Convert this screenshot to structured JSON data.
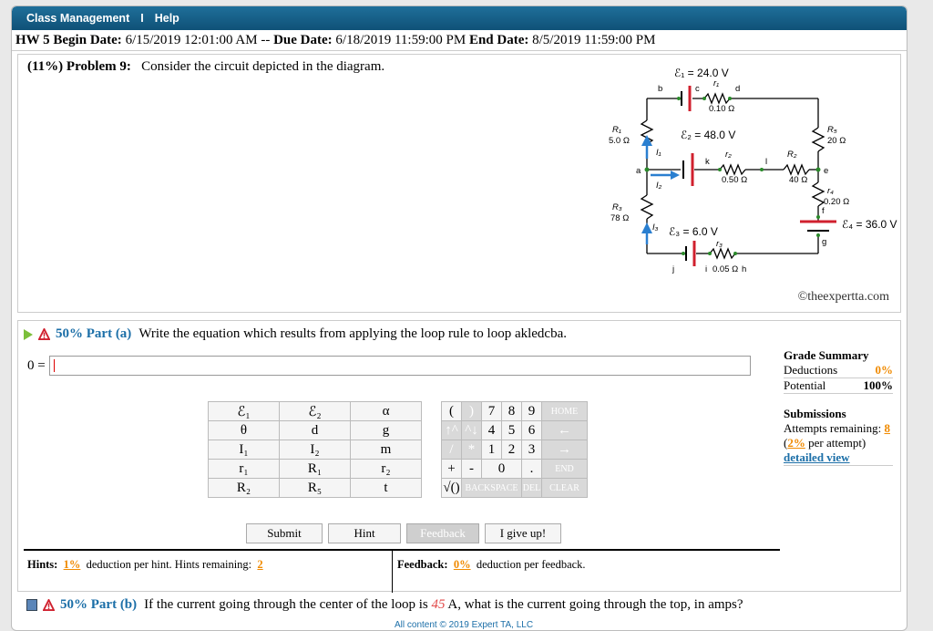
{
  "nav": {
    "class_management": "Class Management",
    "sep": "I",
    "help": "Help"
  },
  "header": {
    "begin_label": "HW 5 Begin Date:",
    "begin": "6/15/2019 12:01:00 AM",
    "dash": "--",
    "due_label": "Due Date:",
    "due": "6/18/2019 11:59:00 PM",
    "end_label": "End Date:",
    "end": "8/5/2019 11:59:00 PM"
  },
  "problem": {
    "number": "(11%) Problem 9:",
    "text": "Consider the circuit depicted in the diagram.",
    "copyright": "©theexpertta.com",
    "circuit_labels": {
      "e1": "ℰ₁",
      "e1_val": "= 24.0 V",
      "e2": "ℰ₂",
      "e2_val": "= 48.0 V",
      "e3": "ℰ₃",
      "e3_val": "= 6.0 V",
      "e4": "ℰ₄",
      "e4_val": "= 36.0 V",
      "r1": "r₁",
      "r1_val": "0.10 Ω",
      "r2": "r₂",
      "r2_val": "0.50 Ω",
      "r3": "r₃",
      "r3_val": "0.05 Ω",
      "r4": "r₄",
      "r4_val": "0.20 Ω",
      "R1": "R₁",
      "R1_val": "5.0 Ω",
      "R2": "R₂",
      "R2_val": "40 Ω",
      "R3": "R₃",
      "R3_val": "78 Ω",
      "R5": "R₅",
      "R5_val": "20 Ω",
      "I1": "I₁",
      "I2": "I₂",
      "I3": "I₃",
      "a": "a",
      "b": "b",
      "c": "c",
      "d": "d",
      "e": "e",
      "f": "f",
      "g": "g",
      "h": "h",
      "i": "i",
      "j": "j",
      "k": "k",
      "l": "l"
    }
  },
  "part_a": {
    "percent": "50%",
    "label": "Part (a)",
    "text": "Write the equation which results from applying the loop rule to loop akledcba.",
    "prefix": "0 =",
    "input_value": ""
  },
  "grade": {
    "title": "Grade Summary",
    "deductions_label": "Deductions",
    "deductions": "0%",
    "potential_label": "Potential",
    "potential": "100%",
    "submissions": "Submissions",
    "attempts_label": "Attempts remaining:",
    "attempts": "8",
    "per_attempt_open": "(",
    "per_attempt_pct": "2%",
    "per_attempt_close": " per attempt)",
    "detailed": "detailed view"
  },
  "keypad": {
    "symbols": [
      [
        "ℰ₁",
        "ℰ₂",
        "α"
      ],
      [
        "θ",
        "d",
        "g"
      ],
      [
        "I₁",
        "I₂",
        "m"
      ],
      [
        "r₁",
        "R₁",
        "r₂"
      ],
      [
        "R₂",
        "R₅",
        "t"
      ]
    ],
    "row1": [
      "(",
      ")",
      "7",
      "8",
      "9",
      "HOME"
    ],
    "row2": [
      "↑^",
      "^↓",
      "4",
      "5",
      "6",
      "←"
    ],
    "row3": [
      "/",
      "*",
      "1",
      "2",
      "3",
      "→"
    ],
    "row4": [
      "+",
      "-",
      "0",
      ".",
      "END"
    ],
    "row5": [
      "√()",
      "BACKSPACE",
      "DEL",
      "CLEAR"
    ]
  },
  "buttons": {
    "submit": "Submit",
    "hint": "Hint",
    "feedback": "Feedback",
    "giveup": "I give up!"
  },
  "hints": {
    "label": "Hints:",
    "pct": "1%",
    "text": "deduction per hint. Hints remaining:",
    "remaining": "2"
  },
  "feedback": {
    "label": "Feedback:",
    "pct": "0%",
    "text": "deduction per feedback."
  },
  "part_b": {
    "percent": "50%",
    "label": "Part (b)",
    "text_before": "If the current going through the center of the loop is",
    "value": "45",
    "text_after": "A, what is the current going through the top, in amps?"
  },
  "footer": "All content © 2019 Expert TA, LLC"
}
